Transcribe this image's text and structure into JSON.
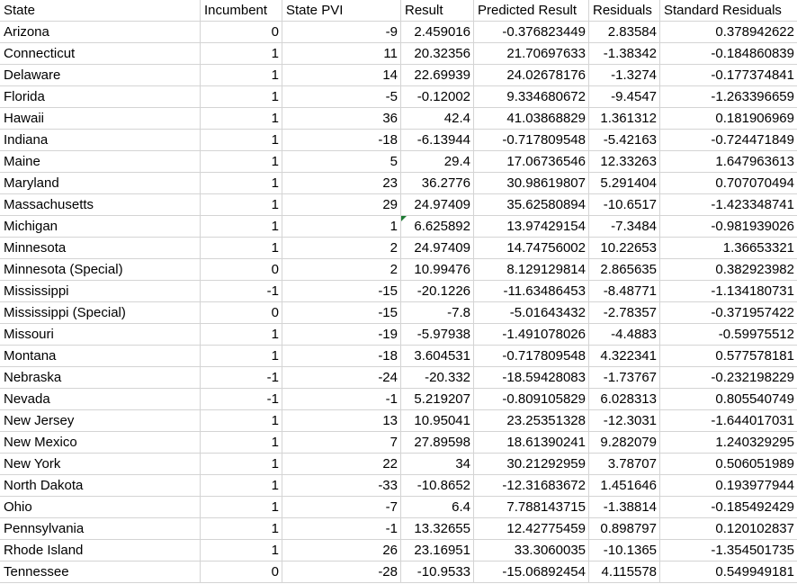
{
  "sheet": {
    "headers": [
      "State",
      "Incumbent",
      "State PVI",
      "Result",
      "Predicted Result",
      "Residuals",
      "Standard Residuals"
    ],
    "rows": [
      [
        "Arizona",
        "0",
        "-9",
        "2.459016",
        "-0.376823449",
        "2.83584",
        "0.378942622"
      ],
      [
        "Connecticut",
        "1",
        "11",
        "20.32356",
        "21.70697633",
        "-1.38342",
        "-0.184860839"
      ],
      [
        "Delaware",
        "1",
        "14",
        "22.69939",
        "24.02678176",
        "-1.3274",
        "-0.177374841"
      ],
      [
        "Florida",
        "1",
        "-5",
        "-0.12002",
        "9.334680672",
        "-9.4547",
        "-1.263396659"
      ],
      [
        "Hawaii",
        "1",
        "36",
        "42.4",
        "41.03868829",
        "1.361312",
        "0.181906969"
      ],
      [
        "Indiana",
        "1",
        "-18",
        "-6.13944",
        "-0.717809548",
        "-5.42163",
        "-0.724471849"
      ],
      [
        "Maine",
        "1",
        "5",
        "29.4",
        "17.06736546",
        "12.33263",
        "1.647963613"
      ],
      [
        "Maryland",
        "1",
        "23",
        "36.2776",
        "30.98619807",
        "5.291404",
        "0.707070494"
      ],
      [
        "Massachusetts",
        "1",
        "29",
        "24.97409",
        "35.62580894",
        "-10.6517",
        "-1.423348741"
      ],
      [
        "Michigan",
        "1",
        "1",
        "6.625892",
        "13.97429154",
        "-7.3484",
        "-0.981939026"
      ],
      [
        "Minnesota",
        "1",
        "2",
        "24.97409",
        "14.74756002",
        "10.22653",
        "1.36653321"
      ],
      [
        "Minnesota (Special)",
        "0",
        "2",
        "10.99476",
        "8.129129814",
        "2.865635",
        "0.382923982"
      ],
      [
        "Mississippi",
        "-1",
        "-15",
        "-20.1226",
        "-11.63486453",
        "-8.48771",
        "-1.134180731"
      ],
      [
        "Mississippi (Special)",
        "0",
        "-15",
        "-7.8",
        "-5.01643432",
        "-2.78357",
        "-0.371957422"
      ],
      [
        "Missouri",
        "1",
        "-19",
        "-5.97938",
        "-1.491078026",
        "-4.4883",
        "-0.59975512"
      ],
      [
        "Montana",
        "1",
        "-18",
        "3.604531",
        "-0.717809548",
        "4.322341",
        "0.577578181"
      ],
      [
        "Nebraska",
        "-1",
        "-24",
        "-20.332",
        "-18.59428083",
        "-1.73767",
        "-0.232198229"
      ],
      [
        "Nevada",
        "-1",
        "-1",
        "5.219207",
        "-0.809105829",
        "6.028313",
        "0.805540749"
      ],
      [
        "New Jersey",
        "1",
        "13",
        "10.95041",
        "23.25351328",
        "-12.3031",
        "-1.644017031"
      ],
      [
        "New Mexico",
        "1",
        "7",
        "27.89598",
        "18.61390241",
        "9.282079",
        "1.240329295"
      ],
      [
        "New York",
        "1",
        "22",
        "34",
        "30.21292959",
        "3.78707",
        "0.506051989"
      ],
      [
        "North Dakota",
        "1",
        "-33",
        "-10.8652",
        "-12.31683672",
        "1.451646",
        "0.193977944"
      ],
      [
        "Ohio",
        "1",
        "-7",
        "6.4",
        "7.788143715",
        "-1.38814",
        "-0.185492429"
      ],
      [
        "Pennsylvania",
        "1",
        "-1",
        "13.32655",
        "12.42775459",
        "0.898797",
        "0.120102837"
      ],
      [
        "Rhode Island",
        "1",
        "26",
        "23.16951",
        "33.3060035",
        "-10.1365",
        "-1.354501735"
      ],
      [
        "Tennessee",
        "0",
        "-28",
        "-10.9533",
        "-15.06892454",
        "4.115578",
        "0.549949181"
      ]
    ],
    "error_flag_cell": {
      "row": 9,
      "col": 3
    },
    "colors": {
      "gridline": "#d4d4d4",
      "error_flag": "#1e7b34"
    }
  }
}
